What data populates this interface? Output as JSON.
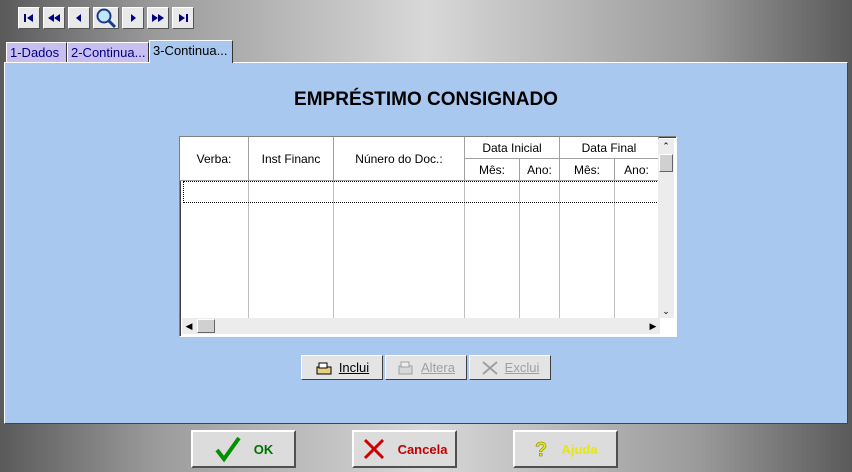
{
  "tabs": [
    {
      "label": "1-Dados"
    },
    {
      "label": "2-Continua..."
    },
    {
      "label": "3-Continua..."
    }
  ],
  "page": {
    "title": "EMPRÉSTIMO CONSIGNADO"
  },
  "grid": {
    "columns": {
      "verba": "Verba:",
      "inst_financ": "Inst Financ",
      "numero_doc": "Núnero do Doc.:",
      "data_inicial": "Data Inicial",
      "data_final": "Data Final",
      "mes": "Mês:",
      "ano": "Ano:"
    }
  },
  "actions": {
    "inclui": "Inclui",
    "altera": "Altera",
    "exclui": "Exclui"
  },
  "footer": {
    "ok": "OK",
    "cancela": "Cancela",
    "ajuda": "Ajuda"
  },
  "colors": {
    "panel": "#a8c8f0",
    "tab_inactive": "#c8bff0",
    "ok_text": "#007000",
    "cancel_text": "#c00000",
    "help_text": "#e8e800"
  },
  "icons": [
    "first-record-icon",
    "previous-page-icon",
    "previous-record-icon",
    "search-icon",
    "next-record-icon",
    "next-page-icon",
    "last-record-icon",
    "checkmark-icon",
    "x-icon",
    "question-mark-icon"
  ]
}
